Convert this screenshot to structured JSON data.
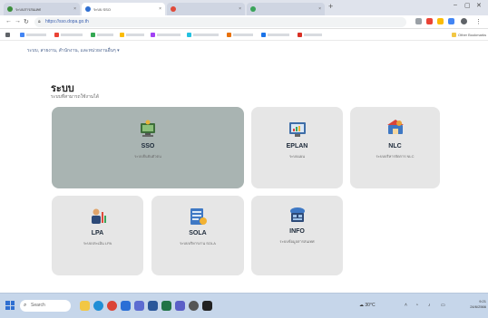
{
  "browser": {
    "tabs": [
      {
        "title": "ระบบสารสนเทศ",
        "fav": "#3b8e3b",
        "active": false
      },
      {
        "title": "ระบบ SSO",
        "fav": "#2f6fd1",
        "active": true
      },
      {
        "title": "",
        "fav": "#e04a3a",
        "active": false
      },
      {
        "title": "",
        "fav": "#3aa45a",
        "active": false
      }
    ],
    "new_tab": "+",
    "url": "https://sso.dopa.go.th",
    "bookmarks": [
      {
        "label": "",
        "color": "#4285f4"
      },
      {
        "label": "",
        "color": "#ea4335"
      },
      {
        "label": "",
        "color": "#34a853"
      },
      {
        "label": "",
        "color": "#fbbc05"
      },
      {
        "label": "",
        "color": "#a142f4"
      },
      {
        "label": "",
        "color": "#24c1e0"
      },
      {
        "label": "",
        "color": "#e8710a"
      },
      {
        "label": "",
        "color": "#1a73e8"
      },
      {
        "label": "",
        "color": "#d93025"
      }
    ],
    "other_bookmarks": "Other Bookmarks"
  },
  "page": {
    "site_bar": "ระบบ, สายงาน, สำนักงาน, และหน่วยงานอื่นๆ ▾",
    "title": "ระบบ",
    "subtitle": "ระบบที่สามารถใช้งานได้"
  },
  "cards": [
    {
      "name": "SSO",
      "desc": "ระบบยืนยันตัวตน"
    },
    {
      "name": "EPLAN",
      "desc": "ระบบแผน"
    },
    {
      "name": "NLC",
      "desc": "ระบบบริหารจัดการ NLC"
    },
    {
      "name": "LPA",
      "desc": "ระบบประเมิน LPA"
    },
    {
      "name": "SOLA",
      "desc": "ระบบบริหารงาน SOLA"
    },
    {
      "name": "INFO",
      "desc": "ระบบข้อมูลสารสนเทศ"
    }
  ],
  "taskbar": {
    "search_placeholder": "Search",
    "apps": [
      {
        "name": "file-explorer-icon",
        "color": "#f2c744"
      },
      {
        "name": "edge-icon",
        "color": "#1f8ed6"
      },
      {
        "name": "chrome-icon",
        "color": "#db4437"
      },
      {
        "name": "mail-icon",
        "color": "#2b6fd6"
      },
      {
        "name": "store-icon",
        "color": "#5d6cd1"
      },
      {
        "name": "word-icon",
        "color": "#2b579a"
      },
      {
        "name": "excel-icon",
        "color": "#217346"
      },
      {
        "name": "teams-icon",
        "color": "#5b5fc7"
      },
      {
        "name": "settings-icon",
        "color": "#555555"
      },
      {
        "name": "terminal-icon",
        "color": "#222222"
      }
    ],
    "weather": "30°C",
    "time": "9:21",
    "date": "24/6/2566"
  }
}
